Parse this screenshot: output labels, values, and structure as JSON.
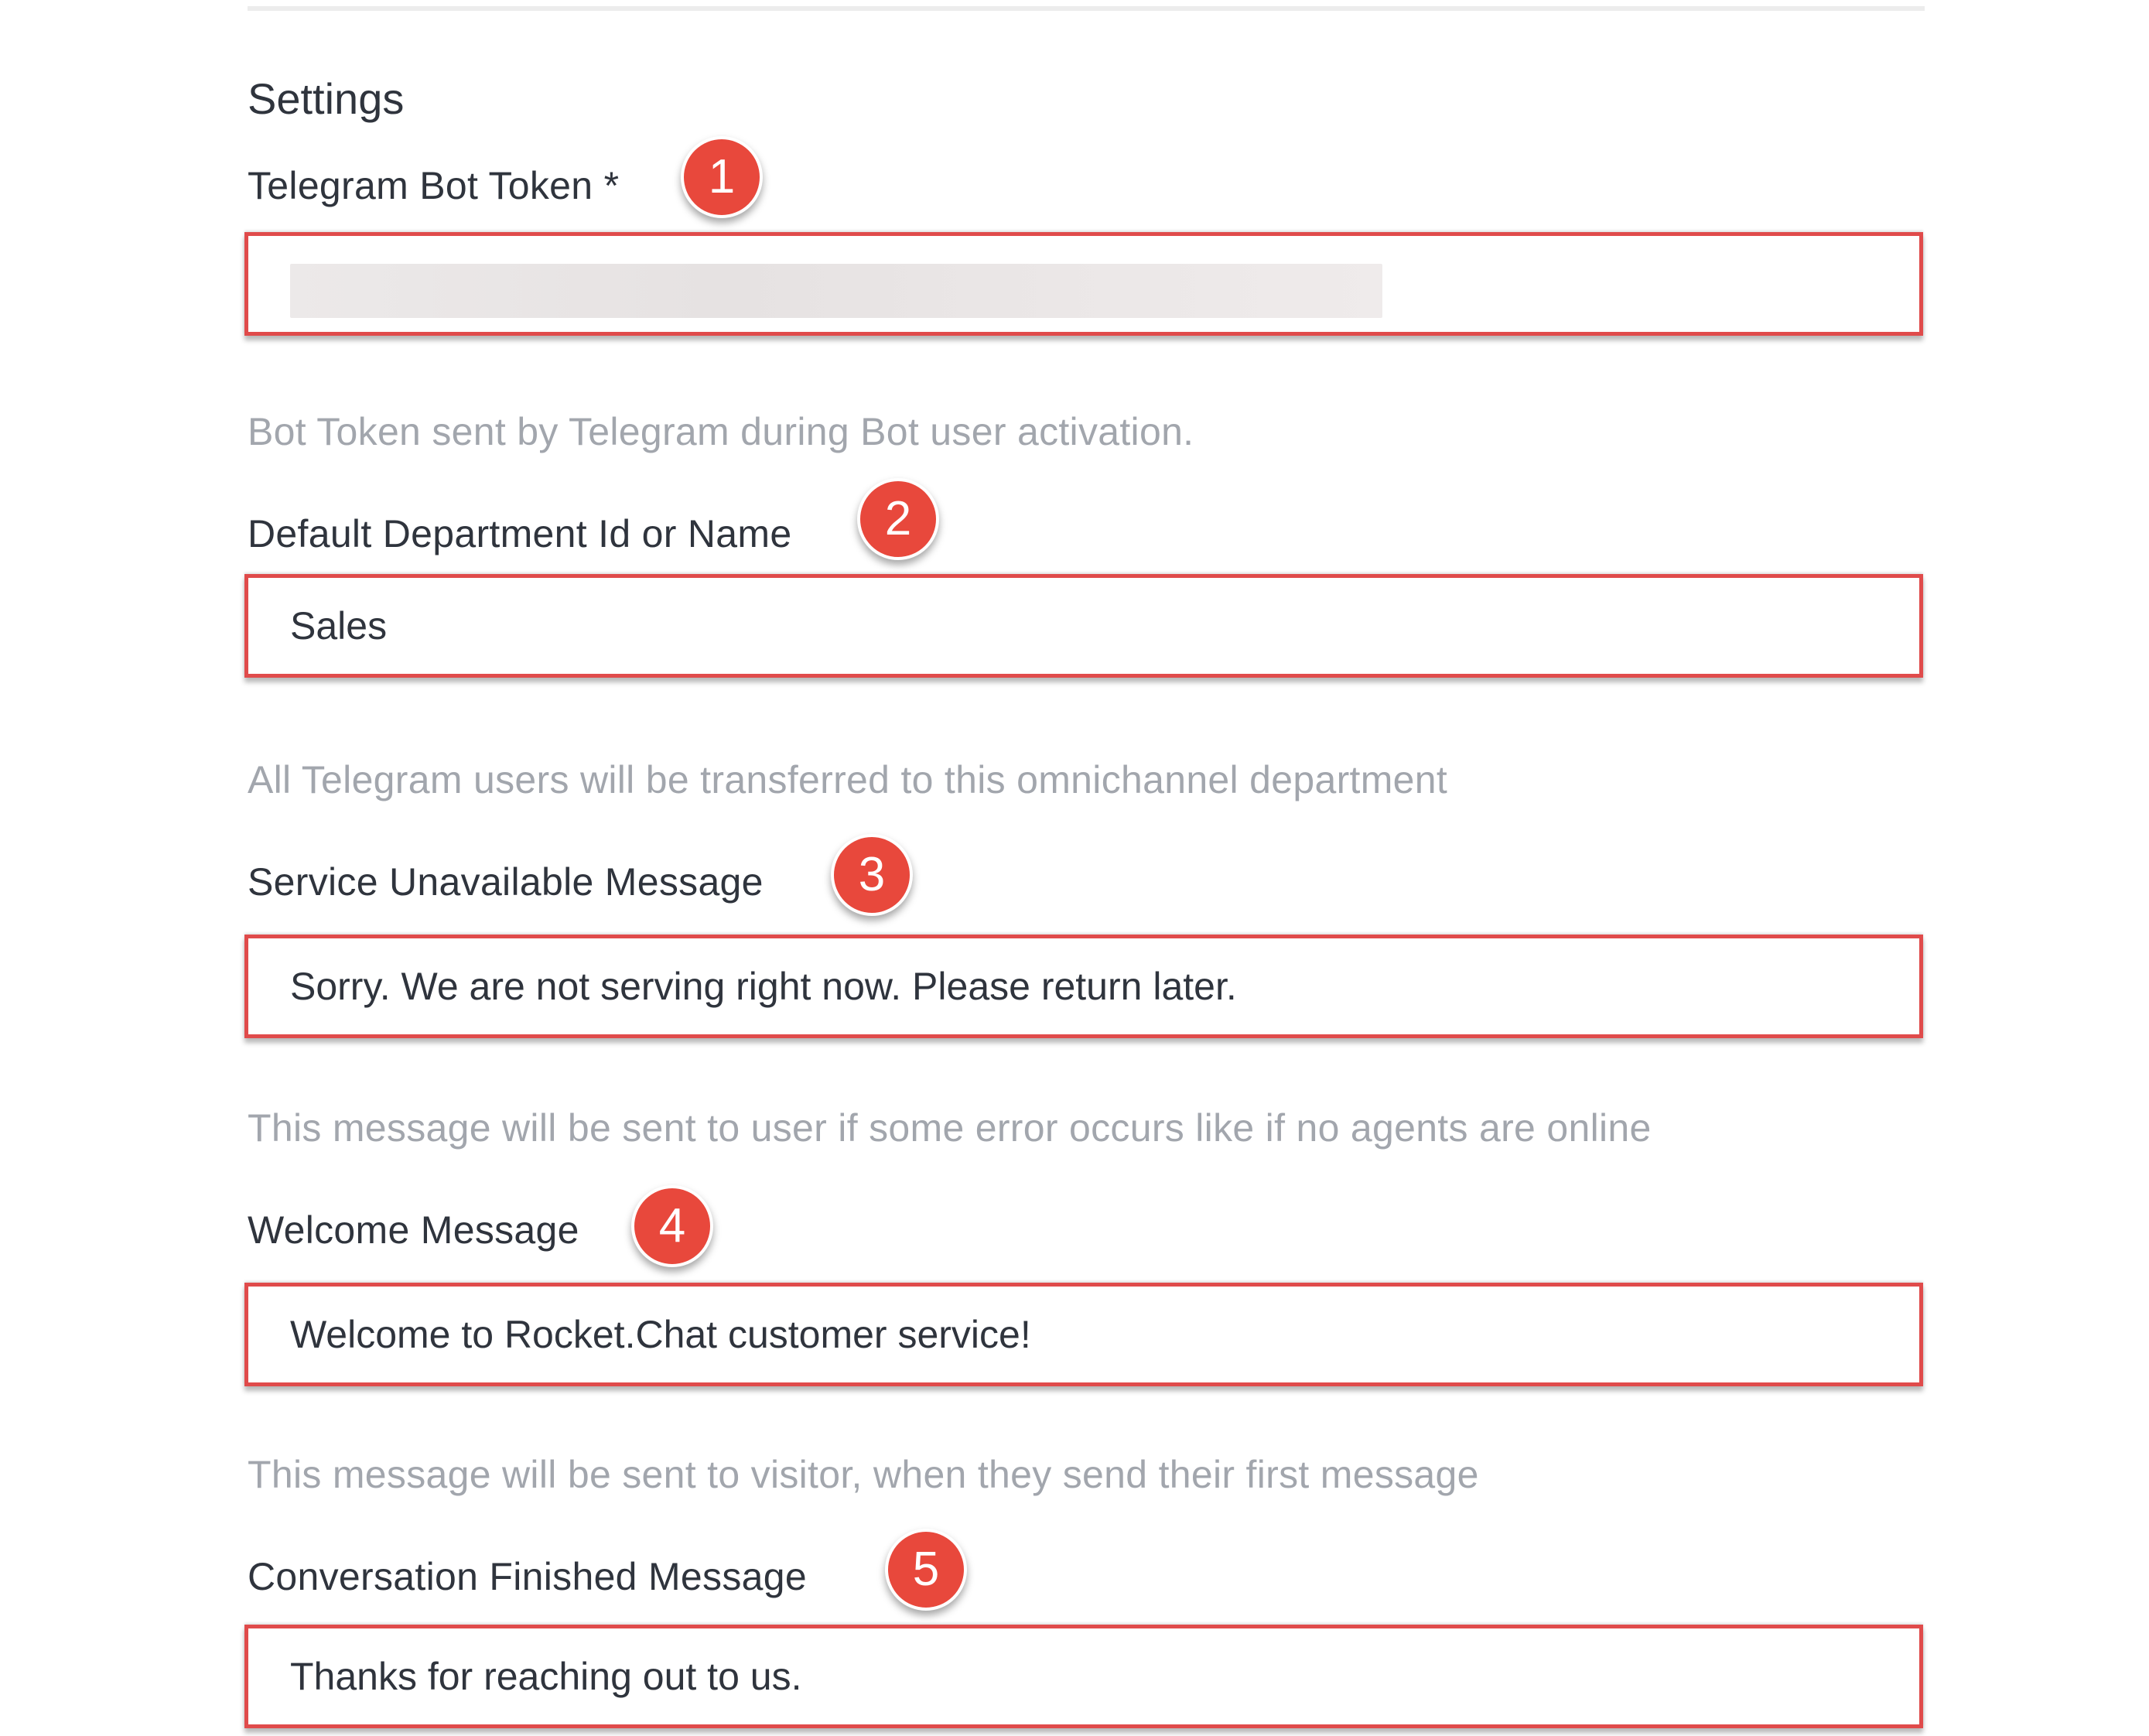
{
  "settings": {
    "title": "Settings",
    "accent_color": "#e8483c",
    "highlight_border_color": "#e04b4b",
    "fields": [
      {
        "label": "Telegram Bot Token *",
        "value": "",
        "value_masked": true,
        "hint": "Bot Token sent by Telegram during Bot user activation.",
        "badge": "1"
      },
      {
        "label": "Default Department Id or Name",
        "value": "Sales",
        "hint": "All Telegram users will be transferred to this omnichannel department",
        "badge": "2"
      },
      {
        "label": "Service Unavailable Message",
        "value": "Sorry. We are not serving right now. Please return later.",
        "hint": "This message will be sent to user if some error occurs like if no agents are online",
        "badge": "3"
      },
      {
        "label": "Welcome Message",
        "value": "Welcome to Rocket.Chat customer service!",
        "hint": "This message will be sent to visitor, when they send their first message",
        "badge": "4"
      },
      {
        "label": "Conversation Finished Message",
        "value": "Thanks for reaching out to us.",
        "badge": "5"
      }
    ]
  }
}
